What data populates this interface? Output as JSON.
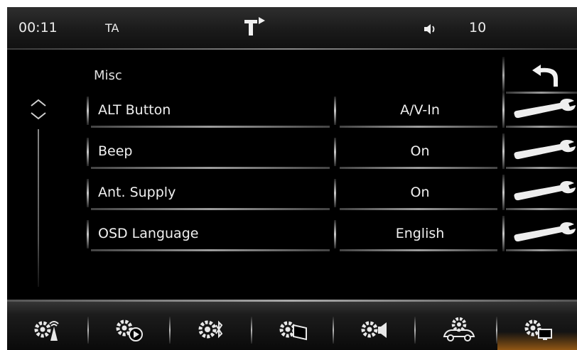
{
  "status_bar": {
    "clock": "00:11",
    "ta_label": "TA",
    "nav_icon": "navigation-turn-icon",
    "volume_icon": "speaker-icon",
    "volume": "10"
  },
  "page": {
    "title": "Misc",
    "back_icon": "back-arrow-icon"
  },
  "scrollbar": {
    "up_icon": "chevron-up-icon",
    "down_icon": "chevron-down-icon"
  },
  "settings": [
    {
      "label": "ALT Button",
      "value": "A/V-In",
      "action_icon": "wrench-icon"
    },
    {
      "label": "Beep",
      "value": "On",
      "action_icon": "wrench-icon"
    },
    {
      "label": "Ant. Supply",
      "value": "On",
      "action_icon": "wrench-icon"
    },
    {
      "label": "OSD Language",
      "value": "English",
      "action_icon": "wrench-icon"
    }
  ],
  "tabs": [
    {
      "name": "radio-settings",
      "icon": "gear-antenna-icon",
      "active": false
    },
    {
      "name": "media-settings",
      "icon": "gear-play-icon",
      "active": false
    },
    {
      "name": "bluetooth-settings",
      "icon": "gear-bluetooth-icon",
      "active": false
    },
    {
      "name": "display-settings",
      "icon": "gear-screen-icon",
      "active": false
    },
    {
      "name": "sound-settings",
      "icon": "gear-speaker-icon",
      "active": false
    },
    {
      "name": "vehicle-settings",
      "icon": "gear-car-icon",
      "active": false
    },
    {
      "name": "misc-settings",
      "icon": "gear-monitor-icon",
      "active": true
    }
  ],
  "colors": {
    "background": "#000000",
    "text": "#f0f0f0",
    "active_tab_glow": "#ff961e"
  }
}
